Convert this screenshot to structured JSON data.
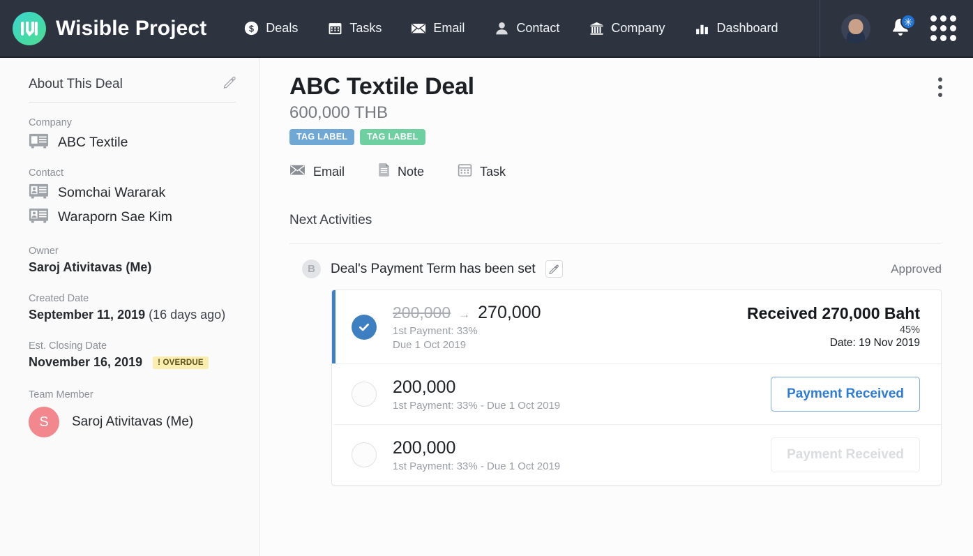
{
  "topnav": {
    "brand": "Wisible Project",
    "logo_gradient_from": "#3ED6D0",
    "logo_gradient_to": "#55DB95",
    "background": "#2D3440",
    "items": [
      {
        "label": "Deals",
        "icon": "dollar-circle-icon"
      },
      {
        "label": "Tasks",
        "icon": "calendar-icon"
      },
      {
        "label": "Email",
        "icon": "envelope-icon"
      },
      {
        "label": "Contact",
        "icon": "person-icon"
      },
      {
        "label": "Company",
        "icon": "building-icon"
      },
      {
        "label": "Dashboard",
        "icon": "bar-chart-icon"
      }
    ],
    "notification_badge": "✳",
    "notification_badge_color": "#1F72D0"
  },
  "sidebar": {
    "title": "About This Deal",
    "company": {
      "label": "Company",
      "value": "ABC Textile"
    },
    "contact": {
      "label": "Contact",
      "values": [
        "Somchai Wararak",
        "Waraporn Sae Kim"
      ]
    },
    "owner": {
      "label": "Owner",
      "value": "Saroj Ativitavas (Me)"
    },
    "created_date": {
      "label": "Created Date",
      "value": "September 11, 2019",
      "relative": "(16 days ago)"
    },
    "closing_date": {
      "label": "Est. Closing Date",
      "value": "November 16, 2019",
      "badge": "! OVERDUE",
      "badge_color": "#FAEDB0"
    },
    "team_member": {
      "label": "Team Member",
      "avatar_initial": "S",
      "avatar_color": "#F2888E",
      "name": "Saroj Ativitavas (Me)"
    }
  },
  "main": {
    "deal_title": "ABC Textile Deal",
    "deal_amount": "600,000 THB",
    "tags": [
      {
        "label": "TAG LABEL",
        "color": "#6FA8D4"
      },
      {
        "label": "TAG LABEL",
        "color": "#6ECFA0"
      }
    ],
    "actions": [
      {
        "label": "Email",
        "icon": "envelope-icon"
      },
      {
        "label": "Note",
        "icon": "note-icon"
      },
      {
        "label": "Task",
        "icon": "calendar-icon"
      }
    ],
    "section_title": "Next Activities",
    "activity": {
      "avatar_initial": "B",
      "text": "Deal's Payment Term has been set",
      "status": "Approved"
    },
    "payments": [
      {
        "state": "received",
        "amount_old": "200,000",
        "arrow": "→",
        "amount_new": "270,000",
        "sub_line1": "1st Payment: 33%",
        "sub_line2": "Due 1 Oct 2019",
        "right_main": "Received 270,000 Baht",
        "right_percent": "45%",
        "right_date": "Date: 19 Nov 2019"
      },
      {
        "state": "pending",
        "amount_plain": "200,000",
        "sub": "1st Payment: 33%  - Due 1 Oct 2019",
        "button_label": "Payment Received",
        "button_enabled": true
      },
      {
        "state": "disabled",
        "amount_plain": "200,000",
        "sub": "1st Payment: 33%  - Due 1 Oct 2019",
        "button_label": "Payment Received",
        "button_enabled": false
      }
    ]
  }
}
